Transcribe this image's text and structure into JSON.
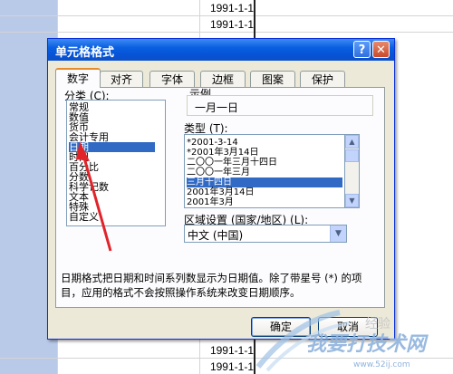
{
  "sheet": {
    "cells": [
      "1991-1-1",
      "1991-1-1",
      "1991-1-1",
      "1991-1-1"
    ]
  },
  "dialog": {
    "title": "单元格格式",
    "help_label": "?",
    "close_label": "✕",
    "tabs": [
      "数字",
      "对齐",
      "字体",
      "边框",
      "图案",
      "保护"
    ],
    "active_tab": "数字",
    "category_label": "分类 (C):",
    "categories": [
      "常规",
      "数值",
      "货币",
      "会计专用",
      "日期",
      "时间",
      "百分比",
      "分数",
      "科学记数",
      "文本",
      "特殊",
      "自定义"
    ],
    "selected_category": "日期",
    "sample_label": "示例",
    "sample_value": "一月一日",
    "type_label": "类型 (T):",
    "types": [
      "*2001-3-14",
      "*2001年3月14日",
      "二〇〇一年三月十四日",
      "二〇〇一年三月",
      "三月十四日",
      "2001年3月14日",
      "2001年3月"
    ],
    "selected_type": "三月十四日",
    "locale_label": "区域设置 (国家/地区) (L):",
    "locale_value": "中文 (中国)",
    "description_line1": "日期格式把日期和时间系列数显示为日期值。除了带星号 (*) 的项",
    "description_line2": "目，应用的格式不会按照操作系统来改变日期顺序。",
    "ok_label": "确定",
    "cancel_label": "取消"
  },
  "watermark": {
    "brand": "我要打技术网",
    "url": "www.52ij.com",
    "jingyan": "经验"
  },
  "colors": {
    "title_bar": "#0a5fe0",
    "selection": "#316ac5",
    "arrow": "#e0242a",
    "dialog_bg": "#ece9d8"
  }
}
